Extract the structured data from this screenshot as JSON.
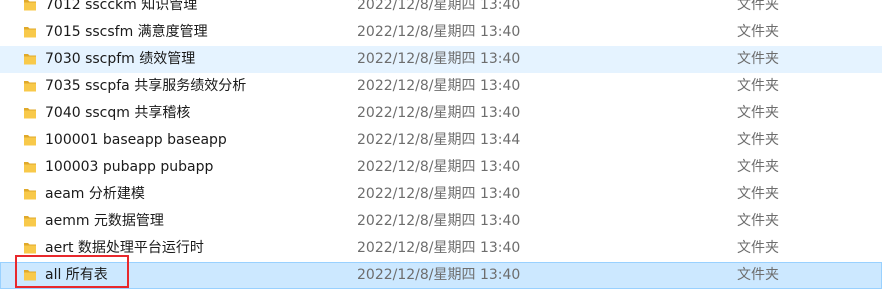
{
  "file_list": {
    "rows": [
      {
        "name": "7012 sscckm 知识管理",
        "modified": "2022/12/8/星期四 13:40",
        "type": "文件夹",
        "state": "normal"
      },
      {
        "name": "7015 sscsfm 满意度管理",
        "modified": "2022/12/8/星期四 13:40",
        "type": "文件夹",
        "state": "normal"
      },
      {
        "name": "7030 sscpfm 绩效管理",
        "modified": "2022/12/8/星期四 13:40",
        "type": "文件夹",
        "state": "hover"
      },
      {
        "name": "7035 sscpfa 共享服务绩效分析",
        "modified": "2022/12/8/星期四 13:40",
        "type": "文件夹",
        "state": "normal"
      },
      {
        "name": "7040 sscqm 共享稽核",
        "modified": "2022/12/8/星期四 13:40",
        "type": "文件夹",
        "state": "normal"
      },
      {
        "name": "100001 baseapp baseapp",
        "modified": "2022/12/8/星期四 13:44",
        "type": "文件夹",
        "state": "normal"
      },
      {
        "name": "100003 pubapp pubapp",
        "modified": "2022/12/8/星期四 13:40",
        "type": "文件夹",
        "state": "normal"
      },
      {
        "name": "aeam 分析建模",
        "modified": "2022/12/8/星期四 13:40",
        "type": "文件夹",
        "state": "normal"
      },
      {
        "name": "aemm 元数据管理",
        "modified": "2022/12/8/星期四 13:40",
        "type": "文件夹",
        "state": "normal"
      },
      {
        "name": "aert 数据处理平台运行时",
        "modified": "2022/12/8/星期四 13:40",
        "type": "文件夹",
        "state": "normal"
      },
      {
        "name": "all  所有表",
        "modified": "2022/12/8/星期四 13:40",
        "type": "文件夹",
        "state": "selected"
      }
    ]
  },
  "colors": {
    "folder": "#f8c94a",
    "folder_dark": "#e0a92a",
    "selected_bg": "#cce8ff",
    "hover_bg": "#e5f3ff",
    "annotation": "#e8282c"
  },
  "icons": {
    "folder": "folder-icon"
  }
}
